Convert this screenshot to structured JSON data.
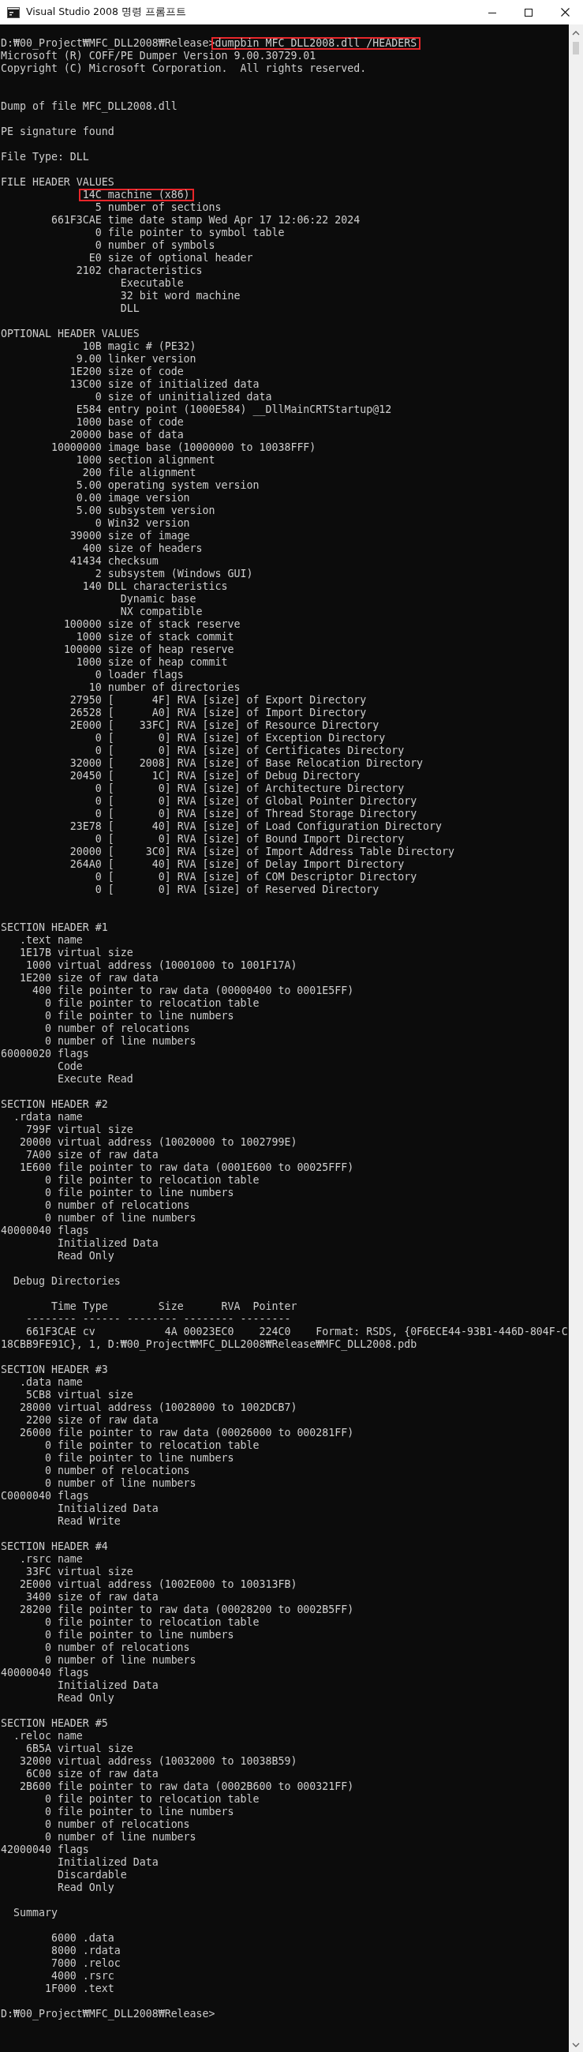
{
  "window": {
    "title": "Visual Studio 2008 명령 프롬프트"
  },
  "console": {
    "lines": [
      {
        "kind": "marked",
        "segments": [
          {
            "text": "D:₩00_Project₩MFC_DLL2008₩Release>",
            "highlighted": false
          },
          {
            "text": "dumpbin MFC_DLL2008.dll /HEADERS",
            "highlighted": true
          }
        ]
      },
      {
        "kind": "text",
        "text": "Microsoft (R) COFF/PE Dumper Version 9.00.30729.01"
      },
      {
        "kind": "text",
        "text": "Copyright (C) Microsoft Corporation.  All rights reserved."
      },
      {
        "kind": "blank"
      },
      {
        "kind": "blank"
      },
      {
        "kind": "text",
        "text": "Dump of file MFC_DLL2008.dll"
      },
      {
        "kind": "blank"
      },
      {
        "kind": "text",
        "text": "PE signature found"
      },
      {
        "kind": "blank"
      },
      {
        "kind": "text",
        "text": "File Type: DLL"
      },
      {
        "kind": "blank"
      },
      {
        "kind": "text",
        "text": "FILE HEADER VALUES"
      },
      {
        "kind": "marked",
        "segments": [
          {
            "text": "             14C machine (x86)",
            "highlighted": true
          }
        ]
      },
      {
        "kind": "text",
        "text": "               5 number of sections"
      },
      {
        "kind": "text",
        "text": "        661F3CAE time date stamp Wed Apr 17 12:06:22 2024"
      },
      {
        "kind": "text",
        "text": "               0 file pointer to symbol table"
      },
      {
        "kind": "text",
        "text": "               0 number of symbols"
      },
      {
        "kind": "text",
        "text": "              E0 size of optional header"
      },
      {
        "kind": "text",
        "text": "            2102 characteristics"
      },
      {
        "kind": "text",
        "text": "                   Executable"
      },
      {
        "kind": "text",
        "text": "                   32 bit word machine"
      },
      {
        "kind": "text",
        "text": "                   DLL"
      },
      {
        "kind": "blank"
      },
      {
        "kind": "text",
        "text": "OPTIONAL HEADER VALUES"
      },
      {
        "kind": "text",
        "text": "             10B magic # (PE32)"
      },
      {
        "kind": "text",
        "text": "            9.00 linker version"
      },
      {
        "kind": "text",
        "text": "           1E200 size of code"
      },
      {
        "kind": "text",
        "text": "           13C00 size of initialized data"
      },
      {
        "kind": "text",
        "text": "               0 size of uninitialized data"
      },
      {
        "kind": "text",
        "text": "            E584 entry point (1000E584) __DllMainCRTStartup@12"
      },
      {
        "kind": "text",
        "text": "            1000 base of code"
      },
      {
        "kind": "text",
        "text": "           20000 base of data"
      },
      {
        "kind": "text",
        "text": "        10000000 image base (10000000 to 10038FFF)"
      },
      {
        "kind": "text",
        "text": "            1000 section alignment"
      },
      {
        "kind": "text",
        "text": "             200 file alignment"
      },
      {
        "kind": "text",
        "text": "            5.00 operating system version"
      },
      {
        "kind": "text",
        "text": "            0.00 image version"
      },
      {
        "kind": "text",
        "text": "            5.00 subsystem version"
      },
      {
        "kind": "text",
        "text": "               0 Win32 version"
      },
      {
        "kind": "text",
        "text": "           39000 size of image"
      },
      {
        "kind": "text",
        "text": "             400 size of headers"
      },
      {
        "kind": "text",
        "text": "           41434 checksum"
      },
      {
        "kind": "text",
        "text": "               2 subsystem (Windows GUI)"
      },
      {
        "kind": "text",
        "text": "             140 DLL characteristics"
      },
      {
        "kind": "text",
        "text": "                   Dynamic base"
      },
      {
        "kind": "text",
        "text": "                   NX compatible"
      },
      {
        "kind": "text",
        "text": "          100000 size of stack reserve"
      },
      {
        "kind": "text",
        "text": "            1000 size of stack commit"
      },
      {
        "kind": "text",
        "text": "          100000 size of heap reserve"
      },
      {
        "kind": "text",
        "text": "            1000 size of heap commit"
      },
      {
        "kind": "text",
        "text": "               0 loader flags"
      },
      {
        "kind": "text",
        "text": "              10 number of directories"
      },
      {
        "kind": "text",
        "text": "           27950 [      4F] RVA [size] of Export Directory"
      },
      {
        "kind": "text",
        "text": "           26528 [      A0] RVA [size] of Import Directory"
      },
      {
        "kind": "text",
        "text": "           2E000 [    33FC] RVA [size] of Resource Directory"
      },
      {
        "kind": "text",
        "text": "               0 [       0] RVA [size] of Exception Directory"
      },
      {
        "kind": "text",
        "text": "               0 [       0] RVA [size] of Certificates Directory"
      },
      {
        "kind": "text",
        "text": "           32000 [    2008] RVA [size] of Base Relocation Directory"
      },
      {
        "kind": "text",
        "text": "           20450 [      1C] RVA [size] of Debug Directory"
      },
      {
        "kind": "text",
        "text": "               0 [       0] RVA [size] of Architecture Directory"
      },
      {
        "kind": "text",
        "text": "               0 [       0] RVA [size] of Global Pointer Directory"
      },
      {
        "kind": "text",
        "text": "               0 [       0] RVA [size] of Thread Storage Directory"
      },
      {
        "kind": "text",
        "text": "           23E78 [      40] RVA [size] of Load Configuration Directory"
      },
      {
        "kind": "text",
        "text": "               0 [       0] RVA [size] of Bound Import Directory"
      },
      {
        "kind": "text",
        "text": "           20000 [     3C0] RVA [size] of Import Address Table Directory"
      },
      {
        "kind": "text",
        "text": "           264A0 [      40] RVA [size] of Delay Import Directory"
      },
      {
        "kind": "text",
        "text": "               0 [       0] RVA [size] of COM Descriptor Directory"
      },
      {
        "kind": "text",
        "text": "               0 [       0] RVA [size] of Reserved Directory"
      },
      {
        "kind": "blank"
      },
      {
        "kind": "blank"
      },
      {
        "kind": "text",
        "text": "SECTION HEADER #1"
      },
      {
        "kind": "text",
        "text": "   .text name"
      },
      {
        "kind": "text",
        "text": "   1E17B virtual size"
      },
      {
        "kind": "text",
        "text": "    1000 virtual address (10001000 to 1001F17A)"
      },
      {
        "kind": "text",
        "text": "   1E200 size of raw data"
      },
      {
        "kind": "text",
        "text": "     400 file pointer to raw data (00000400 to 0001E5FF)"
      },
      {
        "kind": "text",
        "text": "       0 file pointer to relocation table"
      },
      {
        "kind": "text",
        "text": "       0 file pointer to line numbers"
      },
      {
        "kind": "text",
        "text": "       0 number of relocations"
      },
      {
        "kind": "text",
        "text": "       0 number of line numbers"
      },
      {
        "kind": "text",
        "text": "60000020 flags"
      },
      {
        "kind": "text",
        "text": "         Code"
      },
      {
        "kind": "text",
        "text": "         Execute Read"
      },
      {
        "kind": "blank"
      },
      {
        "kind": "text",
        "text": "SECTION HEADER #2"
      },
      {
        "kind": "text",
        "text": "  .rdata name"
      },
      {
        "kind": "text",
        "text": "    799F virtual size"
      },
      {
        "kind": "text",
        "text": "   20000 virtual address (10020000 to 1002799E)"
      },
      {
        "kind": "text",
        "text": "    7A00 size of raw data"
      },
      {
        "kind": "text",
        "text": "   1E600 file pointer to raw data (0001E600 to 00025FFF)"
      },
      {
        "kind": "text",
        "text": "       0 file pointer to relocation table"
      },
      {
        "kind": "text",
        "text": "       0 file pointer to line numbers"
      },
      {
        "kind": "text",
        "text": "       0 number of relocations"
      },
      {
        "kind": "text",
        "text": "       0 number of line numbers"
      },
      {
        "kind": "text",
        "text": "40000040 flags"
      },
      {
        "kind": "text",
        "text": "         Initialized Data"
      },
      {
        "kind": "text",
        "text": "         Read Only"
      },
      {
        "kind": "blank"
      },
      {
        "kind": "text",
        "text": "  Debug Directories"
      },
      {
        "kind": "blank"
      },
      {
        "kind": "text",
        "text": "        Time Type        Size      RVA  Pointer"
      },
      {
        "kind": "text",
        "text": "    -------- ------ -------- -------- --------"
      },
      {
        "kind": "text",
        "text": "    661F3CAE cv           4A 00023EC0    224C0    Format: RSDS, {0F6ECE44-93B1-446D-804F-C"
      },
      {
        "kind": "text",
        "text": "18CBB9FE91C}, 1, D:₩00_Project₩MFC_DLL2008₩Release₩MFC_DLL2008.pdb"
      },
      {
        "kind": "blank"
      },
      {
        "kind": "text",
        "text": "SECTION HEADER #3"
      },
      {
        "kind": "text",
        "text": "   .data name"
      },
      {
        "kind": "text",
        "text": "    5CB8 virtual size"
      },
      {
        "kind": "text",
        "text": "   28000 virtual address (10028000 to 1002DCB7)"
      },
      {
        "kind": "text",
        "text": "    2200 size of raw data"
      },
      {
        "kind": "text",
        "text": "   26000 file pointer to raw data (00026000 to 000281FF)"
      },
      {
        "kind": "text",
        "text": "       0 file pointer to relocation table"
      },
      {
        "kind": "text",
        "text": "       0 file pointer to line numbers"
      },
      {
        "kind": "text",
        "text": "       0 number of relocations"
      },
      {
        "kind": "text",
        "text": "       0 number of line numbers"
      },
      {
        "kind": "text",
        "text": "C0000040 flags"
      },
      {
        "kind": "text",
        "text": "         Initialized Data"
      },
      {
        "kind": "text",
        "text": "         Read Write"
      },
      {
        "kind": "blank"
      },
      {
        "kind": "text",
        "text": "SECTION HEADER #4"
      },
      {
        "kind": "text",
        "text": "   .rsrc name"
      },
      {
        "kind": "text",
        "text": "    33FC virtual size"
      },
      {
        "kind": "text",
        "text": "   2E000 virtual address (1002E000 to 100313FB)"
      },
      {
        "kind": "text",
        "text": "    3400 size of raw data"
      },
      {
        "kind": "text",
        "text": "   28200 file pointer to raw data (00028200 to 0002B5FF)"
      },
      {
        "kind": "text",
        "text": "       0 file pointer to relocation table"
      },
      {
        "kind": "text",
        "text": "       0 file pointer to line numbers"
      },
      {
        "kind": "text",
        "text": "       0 number of relocations"
      },
      {
        "kind": "text",
        "text": "       0 number of line numbers"
      },
      {
        "kind": "text",
        "text": "40000040 flags"
      },
      {
        "kind": "text",
        "text": "         Initialized Data"
      },
      {
        "kind": "text",
        "text": "         Read Only"
      },
      {
        "kind": "blank"
      },
      {
        "kind": "text",
        "text": "SECTION HEADER #5"
      },
      {
        "kind": "text",
        "text": "  .reloc name"
      },
      {
        "kind": "text",
        "text": "    6B5A virtual size"
      },
      {
        "kind": "text",
        "text": "   32000 virtual address (10032000 to 10038B59)"
      },
      {
        "kind": "text",
        "text": "    6C00 size of raw data"
      },
      {
        "kind": "text",
        "text": "   2B600 file pointer to raw data (0002B600 to 000321FF)"
      },
      {
        "kind": "text",
        "text": "       0 file pointer to relocation table"
      },
      {
        "kind": "text",
        "text": "       0 file pointer to line numbers"
      },
      {
        "kind": "text",
        "text": "       0 number of relocations"
      },
      {
        "kind": "text",
        "text": "       0 number of line numbers"
      },
      {
        "kind": "text",
        "text": "42000040 flags"
      },
      {
        "kind": "text",
        "text": "         Initialized Data"
      },
      {
        "kind": "text",
        "text": "         Discardable"
      },
      {
        "kind": "text",
        "text": "         Read Only"
      },
      {
        "kind": "blank"
      },
      {
        "kind": "text",
        "text": "  Summary"
      },
      {
        "kind": "blank"
      },
      {
        "kind": "text",
        "text": "        6000 .data"
      },
      {
        "kind": "text",
        "text": "        8000 .rdata"
      },
      {
        "kind": "text",
        "text": "        7000 .reloc"
      },
      {
        "kind": "text",
        "text": "        4000 .rsrc"
      },
      {
        "kind": "text",
        "text": "       1F000 .text"
      },
      {
        "kind": "blank"
      },
      {
        "kind": "text",
        "text": "D:₩00_Project₩MFC_DLL2008₩Release>"
      }
    ]
  }
}
